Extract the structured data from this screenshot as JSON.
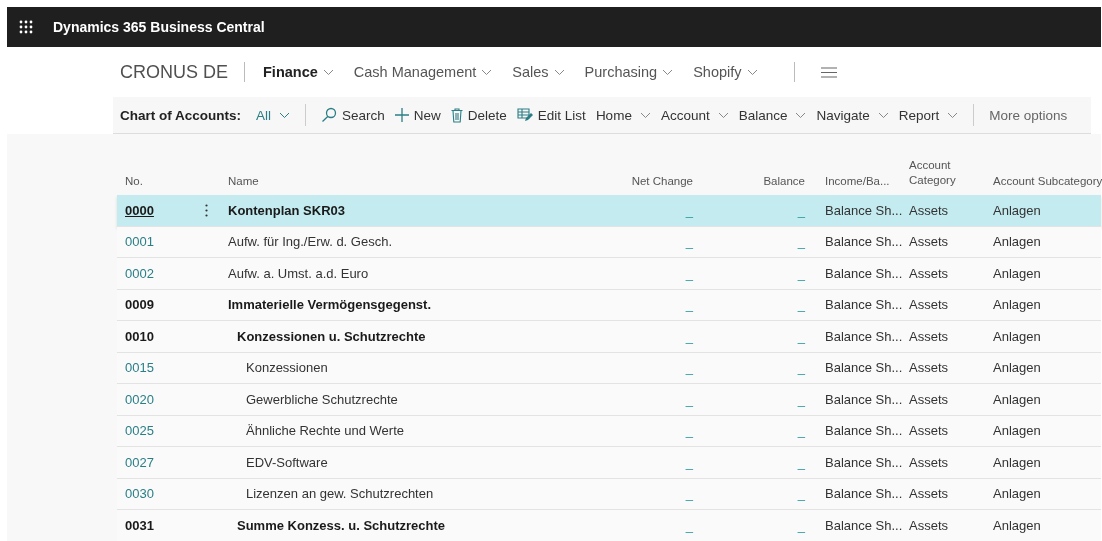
{
  "app_bar": {
    "title": "Dynamics 365 Business Central"
  },
  "nav": {
    "company": "CRONUS DE",
    "items": [
      {
        "label": "Finance",
        "selected": true
      },
      {
        "label": "Cash Management",
        "selected": false
      },
      {
        "label": "Sales",
        "selected": false
      },
      {
        "label": "Purchasing",
        "selected": false
      },
      {
        "label": "Shopify",
        "selected": false
      }
    ]
  },
  "action_bar": {
    "page_title": "Chart of Accounts:",
    "filter": "All",
    "actions": [
      {
        "kind": "search",
        "label": "Search"
      },
      {
        "kind": "new",
        "label": "New"
      },
      {
        "kind": "delete",
        "label": "Delete"
      },
      {
        "kind": "edit",
        "label": "Edit List"
      },
      {
        "kind": "menu",
        "label": "Home"
      },
      {
        "kind": "menu",
        "label": "Account"
      },
      {
        "kind": "menu",
        "label": "Balance"
      },
      {
        "kind": "menu",
        "label": "Navigate"
      },
      {
        "kind": "menu",
        "label": "Report"
      }
    ],
    "more": "More options"
  },
  "table": {
    "columns": [
      "No.",
      "Name",
      "Net Change",
      "Balance",
      "Income/Ba...",
      "Account Category",
      "Account Subcategory"
    ],
    "rows": [
      {
        "no": "0000",
        "name": "Kontenplan SKR03",
        "net_change": "_",
        "balance": "_",
        "income_balance": "Balance Sh...",
        "category": "Assets",
        "subcategory": "Anlagen",
        "kind": "heading",
        "selected": true
      },
      {
        "no": "0001",
        "name": "Aufw. für Ing./Erw. d. Gesch.",
        "net_change": "_",
        "balance": "_",
        "income_balance": "Balance Sh...",
        "category": "Assets",
        "subcategory": "Anlagen",
        "kind": "posting",
        "selected": false
      },
      {
        "no": "0002",
        "name": "Aufw. a. Umst. a.d. Euro",
        "net_change": "_",
        "balance": "_",
        "income_balance": "Balance Sh...",
        "category": "Assets",
        "subcategory": "Anlagen",
        "kind": "posting",
        "selected": false
      },
      {
        "no": "0009",
        "name": "Immaterielle Vermögensgegenst.",
        "net_change": "_",
        "balance": "_",
        "income_balance": "Balance Sh...",
        "category": "Assets",
        "subcategory": "Anlagen",
        "kind": "heading",
        "selected": false,
        "children": [
          {
            "no": "0010",
            "name": "Konzessionen u. Schutzrechte",
            "net_change": "_",
            "balance": "_",
            "income_balance": "Balance Sh...",
            "category": "Assets",
            "subcategory": "Anlagen",
            "kind": "heading",
            "selected": false,
            "children": [
              {
                "no": "0015",
                "name": "Konzessionen",
                "net_change": "_",
                "balance": "_",
                "income_balance": "Balance Sh...",
                "category": "Assets",
                "subcategory": "Anlagen",
                "kind": "posting",
                "selected": false
              },
              {
                "no": "0020",
                "name": "Gewerbliche Schutzrechte",
                "net_change": "_",
                "balance": "_",
                "income_balance": "Balance Sh...",
                "category": "Assets",
                "subcategory": "Anlagen",
                "kind": "posting",
                "selected": false
              },
              {
                "no": "0025",
                "name": "Ähnliche Rechte und Werte",
                "net_change": "_",
                "balance": "_",
                "income_balance": "Balance Sh...",
                "category": "Assets",
                "subcategory": "Anlagen",
                "kind": "posting",
                "selected": false
              },
              {
                "no": "0027",
                "name": "EDV-Software",
                "net_change": "_",
                "balance": "_",
                "income_balance": "Balance Sh...",
                "category": "Assets",
                "subcategory": "Anlagen",
                "kind": "posting",
                "selected": false
              },
              {
                "no": "0030",
                "name": "Lizenzen an gew. Schutzrechten",
                "net_change": "_",
                "balance": "_",
                "income_balance": "Balance Sh...",
                "category": "Assets",
                "subcategory": "Anlagen",
                "kind": "posting",
                "selected": false
              }
            ]
          },
          {
            "no": "0031",
            "name": "Summe Konzess. u. Schutzrechte",
            "net_change": "_",
            "balance": "_",
            "income_balance": "Balance Sh...",
            "category": "Assets",
            "subcategory": "Anlagen",
            "kind": "heading",
            "selected": false
          }
        ]
      }
    ]
  }
}
